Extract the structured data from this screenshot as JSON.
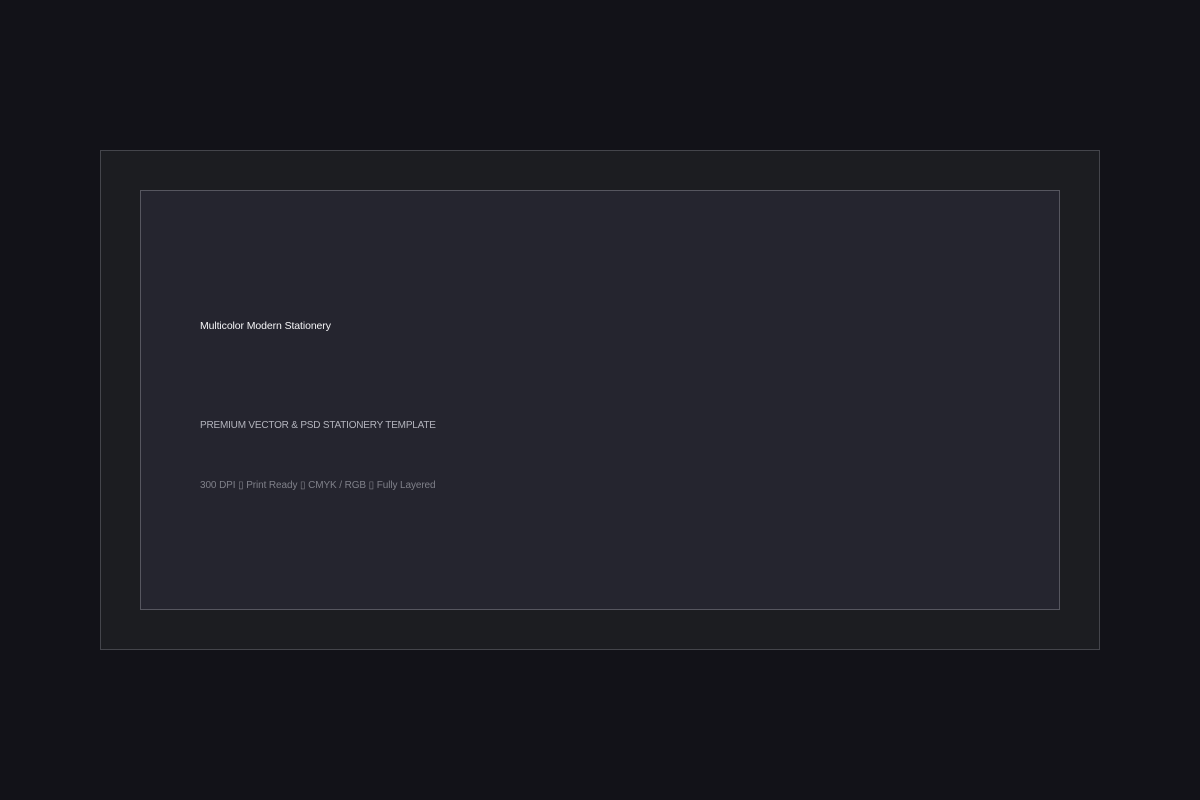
{
  "card": {
    "title": "Multicolor Modern Stationery",
    "subtitle": "PREMIUM VECTOR & PSD STATIONERY TEMPLATE",
    "specs": "300 DPI ▯ Print Ready ▯ CMYK / RGB ▯ Fully Layered"
  },
  "colors": {
    "page_background": "#121218",
    "outer_frame": "#1c1d21",
    "inner_panel": "#25252f"
  }
}
